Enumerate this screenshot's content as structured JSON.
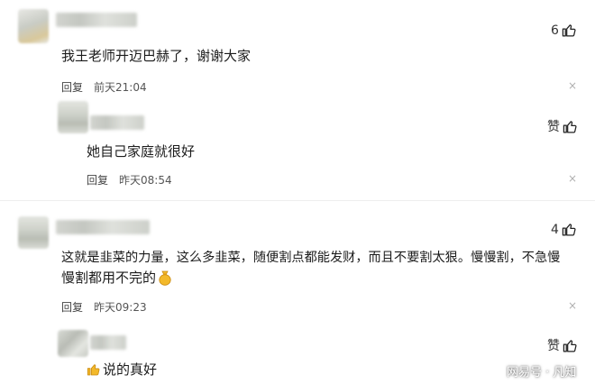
{
  "comments": [
    {
      "text": "我王老师开迈巴赫了，谢谢大家",
      "reply_label": "回复",
      "time": "前天21:04",
      "likes": "6",
      "close": "×",
      "reply": {
        "text": "她自己家庭就很好",
        "reply_label": "回复",
        "time": "昨天08:54",
        "like_label": "赞",
        "close": "×"
      }
    },
    {
      "text_line1": "这就是韭菜的力量，这么多韭菜，随便割点都能发财，而且不要割太狠。慢慢割，不急慢",
      "text_line2": "慢割都用不完的",
      "reply_label": "回复",
      "time": "昨天09:23",
      "likes": "4",
      "close": "×",
      "reply": {
        "text": "说的真好",
        "like_label": "赞"
      }
    }
  ],
  "watermark": "网易号 · 凡知",
  "colors": {
    "like_icon": "#222222",
    "emoji_yellow": "#f3b92a"
  }
}
